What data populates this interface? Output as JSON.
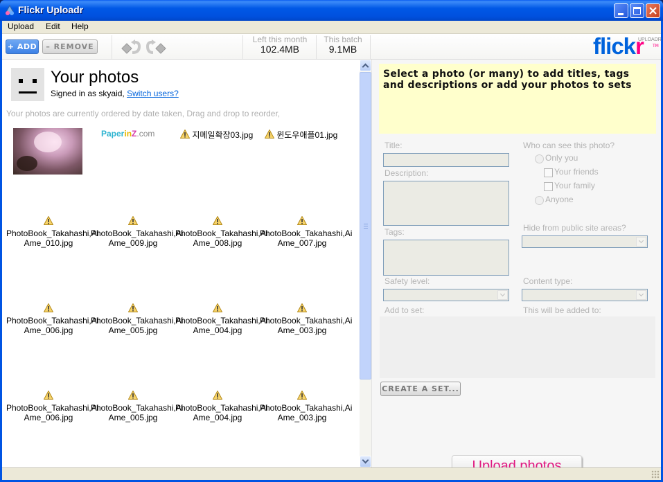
{
  "window": {
    "title": "Flickr Uploadr",
    "controls": [
      "minimize",
      "maximize",
      "close"
    ]
  },
  "menu": {
    "items": [
      {
        "label": "Upload"
      },
      {
        "label": "Edit"
      },
      {
        "label": "Help"
      }
    ]
  },
  "toolbar": {
    "add_label": "+ ADD",
    "remove_label": "– REMOVE",
    "rotate_left_icon": "rotate-left-icon",
    "rotate_right_icon": "rotate-right-icon",
    "stats": [
      {
        "label": "Left this month",
        "value": "102.4MB"
      },
      {
        "label": "This batch",
        "value": "9.1MB"
      }
    ],
    "logo": {
      "main": "flick",
      "accent": "r",
      "sub": "UPLOADR",
      "tm": "TM"
    },
    "colors": {
      "flickr_blue": "#0063dc",
      "flickr_pink": "#ff0084"
    }
  },
  "photos_pane": {
    "title": "Your photos",
    "signed_in_prefix": "Signed in as skyaid, ",
    "switch_link": "Switch users?",
    "order_hint": "Your photos are currently ordered by date taken, Drag and drop to reorder,",
    "first_row": {
      "thumbnail_alt": "photo thumbnail",
      "logo": {
        "p": "Paper",
        "in": "in",
        "z": "Z",
        "com": ".com"
      },
      "files": [
        "지메일확장03.jpg",
        "윈도우애플01.jpg"
      ]
    },
    "grid_rows": [
      [
        {
          "line1": "PhotoBook_Takahashi,Ai",
          "line2": "Ame_010.jpg"
        },
        {
          "line1": "PhotoBook_Takahashi,Ai",
          "line2": "Ame_009.jpg"
        },
        {
          "line1": "PhotoBook_Takahashi,Ai",
          "line2": "Ame_008.jpg"
        },
        {
          "line1": "PhotoBook_Takahashi,Ai",
          "line2": "Ame_007.jpg"
        }
      ],
      [
        {
          "line1": "PhotoBook_Takahashi,Ai",
          "line2": "Ame_006.jpg"
        },
        {
          "line1": "PhotoBook_Takahashi,Ai",
          "line2": "Ame_005.jpg"
        },
        {
          "line1": "PhotoBook_Takahashi,Ai",
          "line2": "Ame_004.jpg"
        },
        {
          "line1": "PhotoBook_Takahashi,Ai",
          "line2": "Ame_003.jpg"
        }
      ],
      [
        {
          "line1": "PhotoBook_Takahashi,Ai",
          "line2": "Ame_006.jpg"
        },
        {
          "line1": "PhotoBook_Takahashi,Ai",
          "line2": "Ame_005.jpg"
        },
        {
          "line1": "PhotoBook_Takahashi,Ai",
          "line2": "Ame_004.jpg"
        },
        {
          "line1": "PhotoBook_Takahashi,Ai",
          "line2": "Ame_003.jpg"
        }
      ]
    ]
  },
  "details_pane": {
    "notice": "Select a photo (or many) to add titles, tags and descriptions or add your photos to sets",
    "title_label": "Title:",
    "title_value": "",
    "description_label": "Description:",
    "description_value": "",
    "tags_label": "Tags:",
    "tags_value": "",
    "privacy_label": "Who can see this photo?",
    "privacy_options": {
      "only_you": "Only you",
      "friends": "Your friends",
      "family": "Your family",
      "anyone": "Anyone"
    },
    "hide_label": "Hide from public site areas?",
    "hide_value": "",
    "safety_label": "Safety level:",
    "safety_value": "",
    "content_label": "Content type:",
    "content_value": "",
    "add_to_set_label": "Add to set:",
    "added_to_label": "This will be added to:",
    "create_set_label": "CREATE A SET...",
    "upload_label": "Upload photos",
    "upload_color": "#e0177f"
  }
}
